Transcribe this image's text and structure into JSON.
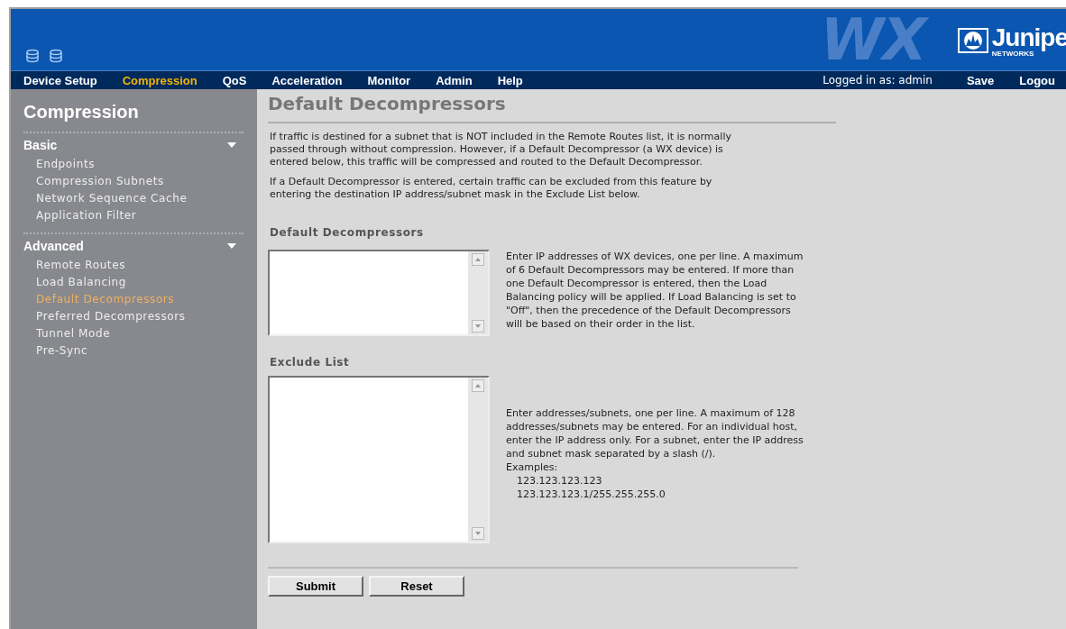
{
  "header": {
    "product_logo": "WX",
    "brand": "Junipe",
    "brand_sub": "NETWORKS"
  },
  "nav": {
    "items": [
      {
        "label": "Device Setup",
        "selected": false
      },
      {
        "label": "Compression",
        "selected": true
      },
      {
        "label": "QoS",
        "selected": false
      },
      {
        "label": "Acceleration",
        "selected": false
      },
      {
        "label": "Monitor",
        "selected": false
      },
      {
        "label": "Admin",
        "selected": false
      },
      {
        "label": "Help",
        "selected": false
      }
    ],
    "user": "Logged in as: admin",
    "actions": [
      "Save",
      "Logou"
    ]
  },
  "sidebar": {
    "title": "Compression",
    "sections": [
      {
        "label": "Basic",
        "expanded": true,
        "items": [
          {
            "label": "Endpoints",
            "selected": false
          },
          {
            "label": "Compression Subnets",
            "selected": false
          },
          {
            "label": "Network Sequence Cache",
            "selected": false
          },
          {
            "label": "Application Filter",
            "selected": false
          }
        ]
      },
      {
        "label": "Advanced",
        "expanded": true,
        "items": [
          {
            "label": "Remote Routes",
            "selected": false
          },
          {
            "label": "Load Balancing",
            "selected": false
          },
          {
            "label": "Default Decompressors",
            "selected": true
          },
          {
            "label": "Preferred Decompressors",
            "selected": false
          },
          {
            "label": "Tunnel Mode",
            "selected": false
          },
          {
            "label": "Pre-Sync",
            "selected": false
          }
        ]
      }
    ]
  },
  "content": {
    "title": "Default Decompressors",
    "paragraphs": [
      "If traffic is destined for a subnet that is NOT included in the Remote Routes list, it is normally passed through without compression. However, if a Default Decompressor (a WX device) is entered below, this traffic will be compressed and routed to the Default Decompressor.",
      "If a Default Decompressor is entered, certain traffic can be excluded from this feature by entering the destination IP address/subnet mask in the Exclude List below."
    ],
    "fields": [
      {
        "label": "Default Decompressors",
        "help": "Enter IP addresses of WX devices, one per line. A maximum of 6 Default Decompressors may be entered. If more than one Default Decompressor is entered, then the Load Balancing policy will be applied. If Load Balancing is set to \"Off\", then the precedence of the Default Decompressors will be based on their order in the list."
      },
      {
        "label": "Exclude List",
        "help": "Enter addresses/subnets, one per line. A maximum of 128 addresses/subnets may be entered. For an individual host, enter the IP address only. For a subnet, enter the IP address and subnet mask separated by a slash (/).",
        "examples_label": "Examples:",
        "examples": [
          "123.123.123.123",
          "123.123.123.1/255.255.255.0"
        ]
      }
    ],
    "buttons": [
      "Submit",
      "Reset"
    ]
  }
}
